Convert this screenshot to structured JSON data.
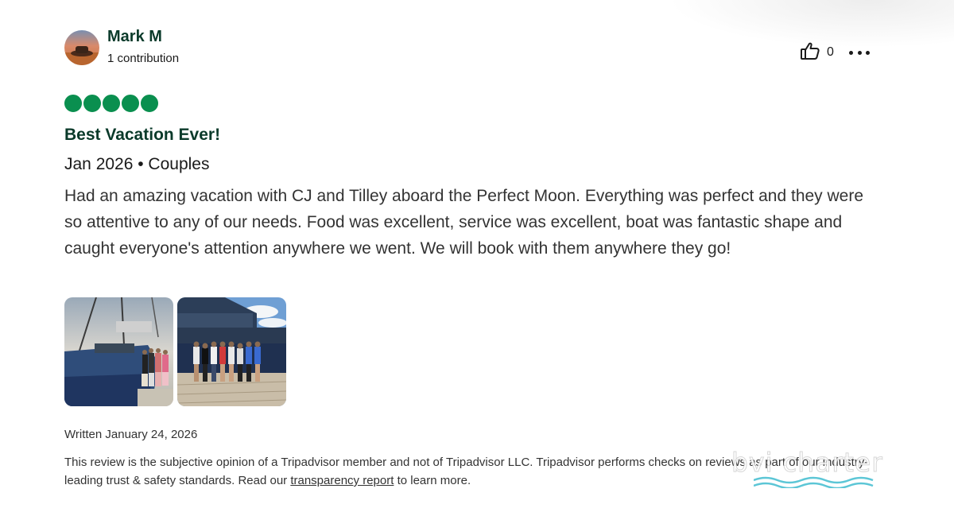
{
  "user": {
    "name": "Mark M",
    "contributions": "1 contribution"
  },
  "actions": {
    "like_count": "0",
    "like_icon": "thumbs-up-icon",
    "more_icon": "more-options-icon"
  },
  "review": {
    "rating": 5,
    "rating_max": 5,
    "rating_color": "#0a8f4f",
    "title": "Best Vacation Ever!",
    "meta": "Jan 2026 • Couples",
    "body": "Had an amazing vacation with CJ and Tilley aboard the Perfect Moon. Everything was perfect and they were so attentive to any of our needs. Food was excellent, service was excellent, boat was fantastic shape and caught everyone's attention anywhere we went. We will book with them anywhere they go!",
    "photos": [
      "catamaran-group-photo",
      "dock-group-photo"
    ],
    "written": "Written January 24, 2026"
  },
  "disclaimer": {
    "text_before": "This review is the subjective opinion of a Tripadvisor member and not of Tripadvisor LLC. Tripadvisor performs checks on reviews as part of our industry-leading trust & safety standards. Read our ",
    "link_text": "transparency report",
    "text_after": " to learn more."
  },
  "watermark": {
    "text": "bvi charter",
    "color": "#5cc6d6"
  }
}
